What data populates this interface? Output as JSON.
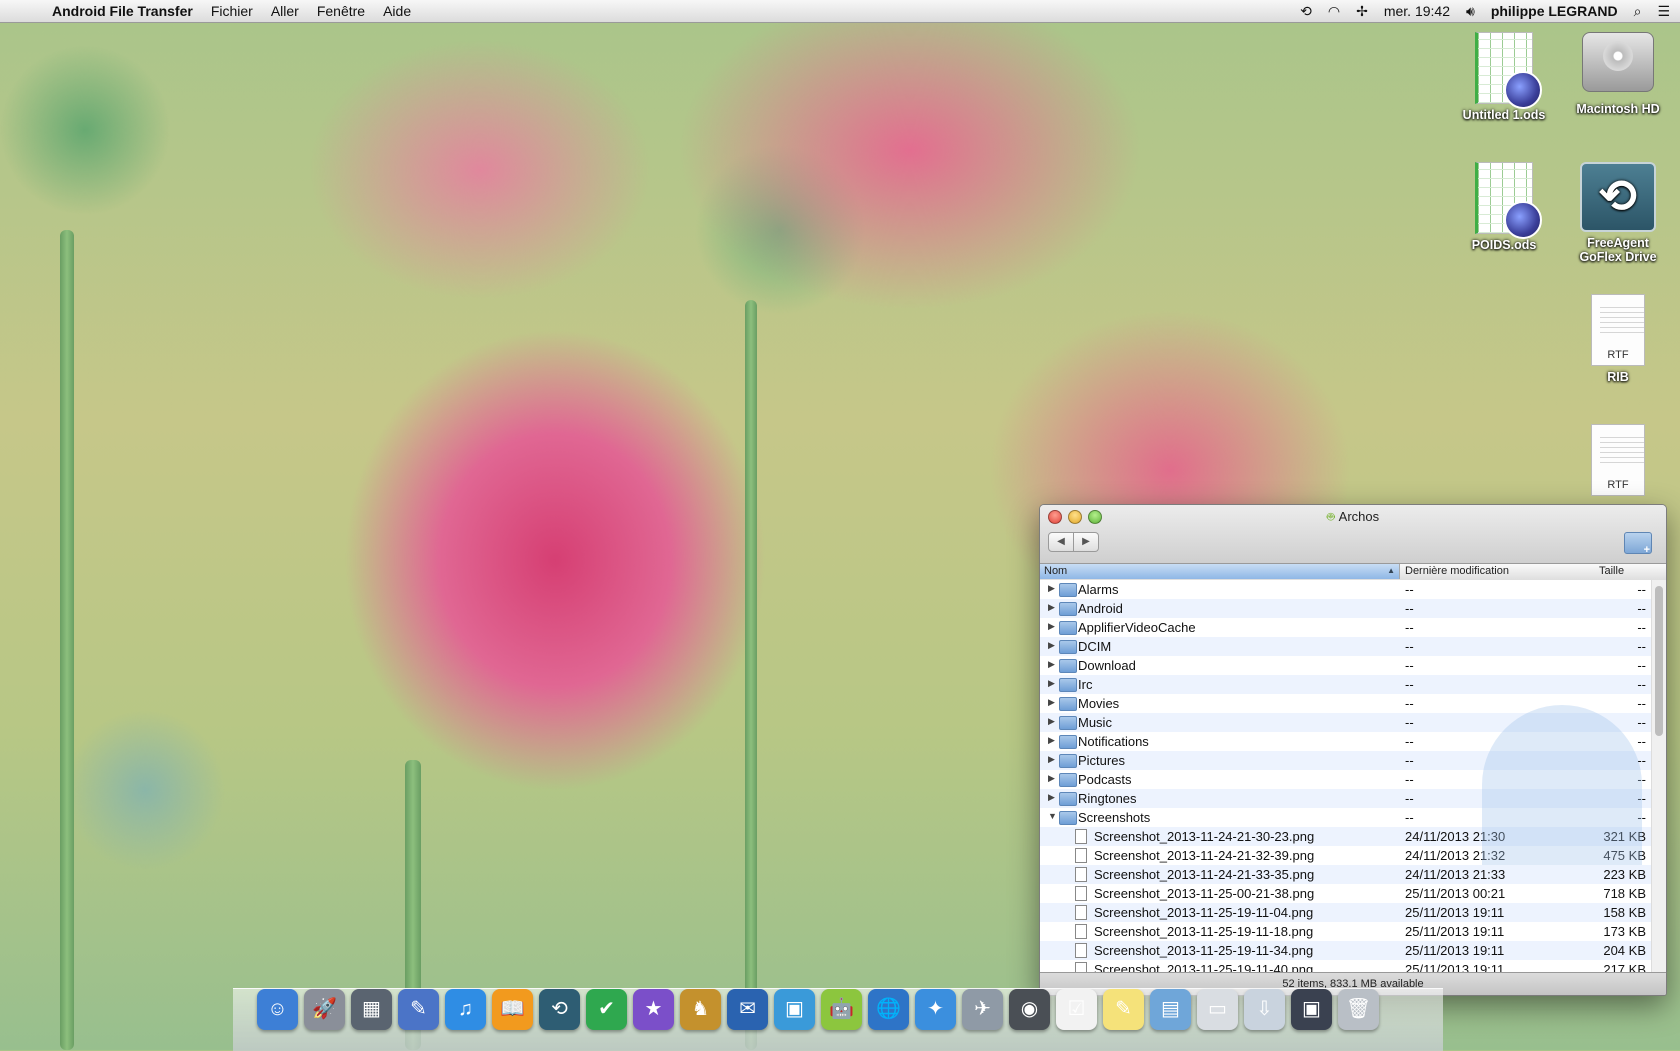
{
  "menubar": {
    "app": "Android File Transfer",
    "menus": [
      "Fichier",
      "Aller",
      "Fenêtre",
      "Aide"
    ],
    "clock": "mer. 19:42",
    "user": "philippe LEGRAND"
  },
  "desktop": {
    "icons": [
      {
        "label": "Untitled 1.ods",
        "kind": "ods"
      },
      {
        "label": "Macintosh HD",
        "kind": "hd"
      },
      {
        "label": "POIDS.ods",
        "kind": "ods"
      },
      {
        "label": "FreeAgent GoFlex Drive",
        "kind": "time-machine"
      },
      {
        "label": "RIB",
        "kind": "rtf",
        "badge": "RTF"
      },
      {
        "label": "",
        "kind": "rtf",
        "badge": "RTF"
      }
    ]
  },
  "window": {
    "title": "Archos",
    "columns": {
      "name": "Nom",
      "date": "Dernière modification",
      "size": "Taille"
    },
    "rows": [
      {
        "name": "Alarms",
        "date": "--",
        "size": "--",
        "type": "folder",
        "expanded": false
      },
      {
        "name": "Android",
        "date": "--",
        "size": "--",
        "type": "folder",
        "expanded": false
      },
      {
        "name": "ApplifierVideoCache",
        "date": "--",
        "size": "--",
        "type": "folder",
        "expanded": false
      },
      {
        "name": "DCIM",
        "date": "--",
        "size": "--",
        "type": "folder",
        "expanded": false
      },
      {
        "name": "Download",
        "date": "--",
        "size": "--",
        "type": "folder",
        "expanded": false
      },
      {
        "name": "Irc",
        "date": "--",
        "size": "--",
        "type": "folder",
        "expanded": false
      },
      {
        "name": "Movies",
        "date": "--",
        "size": "--",
        "type": "folder",
        "expanded": false
      },
      {
        "name": "Music",
        "date": "--",
        "size": "--",
        "type": "folder",
        "expanded": false
      },
      {
        "name": "Notifications",
        "date": "--",
        "size": "--",
        "type": "folder",
        "expanded": false
      },
      {
        "name": "Pictures",
        "date": "--",
        "size": "--",
        "type": "folder",
        "expanded": false
      },
      {
        "name": "Podcasts",
        "date": "--",
        "size": "--",
        "type": "folder",
        "expanded": false
      },
      {
        "name": "Ringtones",
        "date": "--",
        "size": "--",
        "type": "folder",
        "expanded": false
      },
      {
        "name": "Screenshots",
        "date": "--",
        "size": "--",
        "type": "folder",
        "expanded": true
      },
      {
        "name": "Screenshot_2013-11-24-21-30-23.png",
        "date": "24/11/2013 21:30",
        "size": "321 KB",
        "type": "file"
      },
      {
        "name": "Screenshot_2013-11-24-21-32-39.png",
        "date": "24/11/2013 21:32",
        "size": "475 KB",
        "type": "file"
      },
      {
        "name": "Screenshot_2013-11-24-21-33-35.png",
        "date": "24/11/2013 21:33",
        "size": "223 KB",
        "type": "file"
      },
      {
        "name": "Screenshot_2013-11-25-00-21-38.png",
        "date": "25/11/2013 00:21",
        "size": "718 KB",
        "type": "file"
      },
      {
        "name": "Screenshot_2013-11-25-19-11-04.png",
        "date": "25/11/2013 19:11",
        "size": "158 KB",
        "type": "file"
      },
      {
        "name": "Screenshot_2013-11-25-19-11-18.png",
        "date": "25/11/2013 19:11",
        "size": "173 KB",
        "type": "file"
      },
      {
        "name": "Screenshot_2013-11-25-19-11-34.png",
        "date": "25/11/2013 19:11",
        "size": "204 KB",
        "type": "file"
      },
      {
        "name": "Screenshot_2013-11-25-19-11-40.png",
        "date": "25/11/2013 19:11",
        "size": "217 KB",
        "type": "file"
      }
    ],
    "status": "52 items, 833.1 MB available"
  },
  "dock": {
    "items": [
      {
        "icon": "finder-icon",
        "color": "#3d7fd6",
        "glyph": "☺"
      },
      {
        "icon": "launchpad-icon",
        "color": "#8a8f99",
        "glyph": "🚀"
      },
      {
        "icon": "photo-browser-icon",
        "color": "#5a6470",
        "glyph": "▦"
      },
      {
        "icon": "dashboard-icon",
        "color": "#4b74c7",
        "glyph": "✎"
      },
      {
        "icon": "itunes-icon",
        "color": "#2f8de4",
        "glyph": "♫"
      },
      {
        "icon": "ibooks-icon",
        "color": "#f29a1e",
        "glyph": "📖"
      },
      {
        "icon": "time-machine-icon",
        "color": "#2e5d73",
        "glyph": "⟲"
      },
      {
        "icon": "checkmark-app-icon",
        "color": "#2fa84f",
        "glyph": "✔"
      },
      {
        "icon": "imovie-icon",
        "color": "#7b4fc9",
        "glyph": "★"
      },
      {
        "icon": "game-app-icon",
        "color": "#c4912d",
        "glyph": "♞"
      },
      {
        "icon": "thunderbird-icon",
        "color": "#2a63b0",
        "glyph": "✉"
      },
      {
        "icon": "iphoto-icon",
        "color": "#3a9ad9",
        "glyph": "▣"
      },
      {
        "icon": "android-file-transfer-icon",
        "color": "#8cc63e",
        "glyph": "🤖"
      },
      {
        "icon": "globe-icon",
        "color": "#2e74c7",
        "glyph": "🌐"
      },
      {
        "icon": "safari-icon",
        "color": "#3b8fde",
        "glyph": "✦"
      },
      {
        "icon": "mail-icon",
        "color": "#8f9aa6",
        "glyph": "✈"
      },
      {
        "icon": "facetime-icon",
        "color": "#4a4f55",
        "glyph": "◉"
      },
      {
        "icon": "reminders-icon",
        "color": "#f2f2f2",
        "glyph": "☑"
      },
      {
        "icon": "stickies-icon",
        "color": "#f5e27a",
        "glyph": "✎"
      },
      {
        "icon": "preview-icon",
        "color": "#6fa6d9",
        "glyph": "▤"
      },
      {
        "icon": "document-stack-icon",
        "color": "#d9dde2",
        "glyph": "▭"
      },
      {
        "icon": "downloads-stack-icon",
        "color": "#c9d3de",
        "glyph": "⇩"
      },
      {
        "icon": "screen-capture-icon",
        "color": "#3a4150",
        "glyph": "▣"
      },
      {
        "icon": "trash-icon",
        "color": "#b9bfc6",
        "glyph": "🗑"
      }
    ]
  }
}
